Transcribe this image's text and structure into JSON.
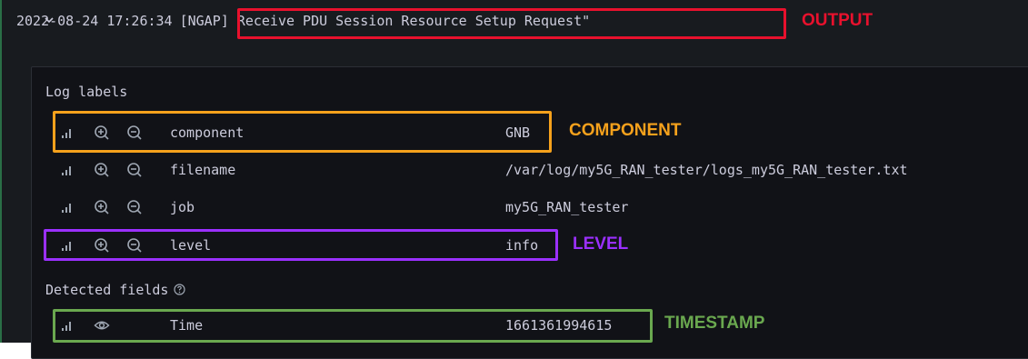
{
  "log_entry": {
    "timestamp": "2022-08-24 17:26:34",
    "message": "[NGAP] Receive PDU Session Resource Setup Request\""
  },
  "log_labels": {
    "title": "Log labels",
    "items": [
      {
        "key": "component",
        "value": "GNB"
      },
      {
        "key": "filename",
        "value": "/var/log/my5G_RAN_tester/logs_my5G_RAN_tester.txt"
      },
      {
        "key": "job",
        "value": "my5G_RAN_tester"
      },
      {
        "key": "level",
        "value": "info"
      }
    ]
  },
  "detected_fields": {
    "title": "Detected fields",
    "items": [
      {
        "key": "Time",
        "value": "1661361994615"
      }
    ]
  },
  "annotations": {
    "output": {
      "label": "OUTPUT",
      "color": "#e8112d"
    },
    "component": {
      "label": "COMPONENT",
      "color": "#f5a11c"
    },
    "level": {
      "label": "LEVEL",
      "color": "#9b30ff"
    },
    "timestamp": {
      "label": "TIMESTAMP",
      "color": "#6aa84f"
    }
  },
  "icons": [
    "chevron-down-icon",
    "stats-bars-icon",
    "zoom-in-icon",
    "zoom-out-icon",
    "eye-icon",
    "help-circle-icon"
  ]
}
